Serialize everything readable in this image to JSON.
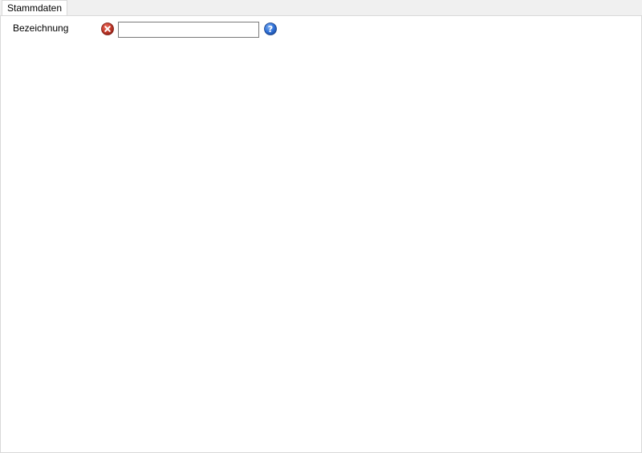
{
  "tabs": [
    {
      "label": "Stammdaten",
      "active": true
    }
  ],
  "form": {
    "fields": [
      {
        "label": "Bezeichnung",
        "value": "",
        "status_icon": "error-icon",
        "help_icon": "help-icon"
      }
    ]
  },
  "colors": {
    "error_icon": "#c0392b",
    "help_icon": "#2f6fd6",
    "panel_background": "#ffffff",
    "window_background": "#f0f0f0",
    "border": "#d9d9d9"
  }
}
